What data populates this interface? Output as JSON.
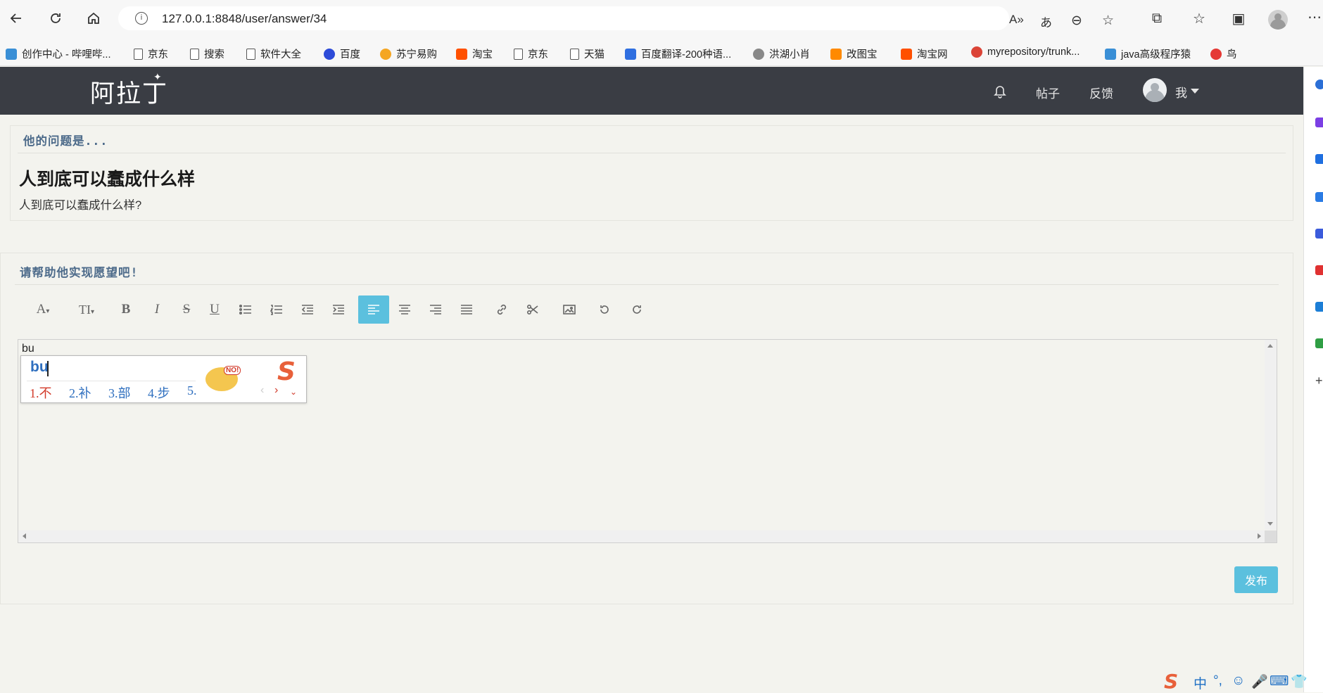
{
  "browser": {
    "url": "127.0.0.1:8848/user/answer/34",
    "bookmarks": [
      {
        "label": "创作中心 - 哔哩哔...",
        "icon": "bilibili-icon",
        "color": "#3a8fd6"
      },
      {
        "label": "京东",
        "icon": "page-icon"
      },
      {
        "label": "搜索",
        "icon": "page-icon"
      },
      {
        "label": "软件大全",
        "icon": "page-icon"
      },
      {
        "label": "百度",
        "icon": "baidu-paw-icon",
        "color": "#2d4bd8"
      },
      {
        "label": "苏宁易购",
        "icon": "suning-icon",
        "color": "#f5a623"
      },
      {
        "label": "淘宝",
        "icon": "taobao-icon",
        "color": "#ff5000"
      },
      {
        "label": "京东",
        "icon": "page-icon"
      },
      {
        "label": "天猫",
        "icon": "page-icon"
      },
      {
        "label": "百度翻译-200种语...",
        "icon": "baidu-translate-icon",
        "color": "#2f6fe0"
      },
      {
        "label": "洪湖小肖",
        "icon": "bird-icon",
        "color": "#888888"
      },
      {
        "label": "改图宝",
        "icon": "gaitubao-icon",
        "color": "#ff8a00"
      },
      {
        "label": "淘宝网",
        "icon": "taobao-icon",
        "color": "#ff5000"
      },
      {
        "label": "myrepository/trunk...",
        "icon": "chrome-icon",
        "color": "#db4437"
      },
      {
        "label": "java高级程序猿",
        "icon": "bilibili-icon",
        "color": "#3a8fd6"
      },
      {
        "label": "鸟",
        "icon": "bird-red-icon",
        "color": "#e53935"
      }
    ]
  },
  "navbar": {
    "logo": "阿拉丁",
    "bell_icon": "bell-icon",
    "links": [
      "帖子",
      "反馈"
    ],
    "user_label": "我"
  },
  "question": {
    "panel_title": "他的问题是...",
    "title": "人到底可以蠢成什么样",
    "body": "人到底可以蠢成什么样?"
  },
  "answer": {
    "panel_title": "请帮助他实现愿望吧!",
    "toolbar": [
      {
        "name": "font-family-button",
        "icon": "font-icon",
        "glyph": "A▾"
      },
      {
        "name": "font-size-button",
        "icon": "text-height-icon",
        "glyph": "TI▾"
      },
      {
        "name": "bold-button",
        "icon": "bold-icon",
        "glyph": "B"
      },
      {
        "name": "italic-button",
        "icon": "italic-icon",
        "glyph": "I"
      },
      {
        "name": "strikethrough-button",
        "icon": "strikethrough-icon",
        "glyph": "S"
      },
      {
        "name": "underline-button",
        "icon": "underline-icon",
        "glyph": "U"
      },
      {
        "name": "bullet-list-button",
        "icon": "list-ul-icon"
      },
      {
        "name": "numbered-list-button",
        "icon": "list-ol-icon"
      },
      {
        "name": "outdent-button",
        "icon": "outdent-icon"
      },
      {
        "name": "indent-button",
        "icon": "indent-icon"
      },
      {
        "name": "align-left-button",
        "icon": "align-left-icon",
        "active": true
      },
      {
        "name": "align-center-button",
        "icon": "align-center-icon"
      },
      {
        "name": "align-right-button",
        "icon": "align-right-icon"
      },
      {
        "name": "justify-button",
        "icon": "align-justify-icon"
      },
      {
        "name": "link-button",
        "icon": "link-icon"
      },
      {
        "name": "unlink-button",
        "icon": "scissors-icon"
      },
      {
        "name": "image-button",
        "icon": "image-icon"
      },
      {
        "name": "undo-button",
        "icon": "undo-icon"
      },
      {
        "name": "redo-button",
        "icon": "redo-icon"
      }
    ],
    "editor_text": "bu",
    "publish_label": "发布"
  },
  "ime": {
    "composition": "bu",
    "candidates": [
      "1.不",
      "2.补",
      "3.部",
      "4.步",
      "5."
    ],
    "status": [
      "中",
      "°,",
      "☺",
      "🎤",
      "⌨",
      "👕"
    ]
  },
  "colors": {
    "navbar_bg": "#3a3d44",
    "page_bg": "#f3f3ee",
    "accent": "#5bc0de",
    "panel_title": "#4d6b8a"
  }
}
